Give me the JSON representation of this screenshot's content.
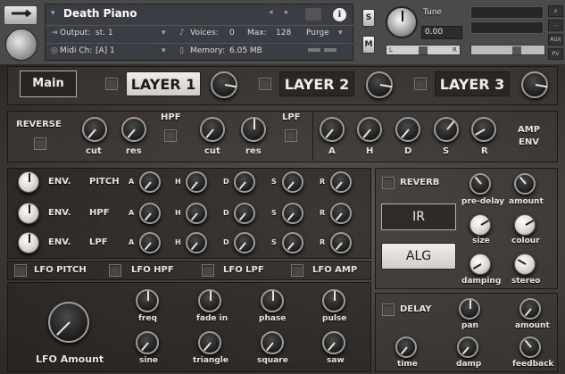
{
  "header": {
    "instrument_name": "Death Piano",
    "output_label": "Output:",
    "output_value": "st. 1",
    "midi_label": "Midi Ch:",
    "midi_value": "[A] 1",
    "voices_label": "Voices:",
    "voices_value": "0",
    "max_label": "Max:",
    "max_value": "128",
    "memory_label": "Memory:",
    "memory_value": "6.05 MB",
    "purge_label": "Purge",
    "solo_label": "S",
    "mute_label": "M",
    "tune_label": "Tune",
    "tune_value": "0.00",
    "pan_left": "L",
    "pan_right": "R",
    "aux_label": "AUX",
    "pv_label": "PV",
    "close_label": "x",
    "minus_label": "-"
  },
  "layers": {
    "main_label": "Main",
    "layer1": "LAYER 1",
    "layer2": "LAYER 2",
    "layer3": "LAYER 3"
  },
  "filters": {
    "reverse": "REVERSE",
    "hpf": "HPF",
    "lpf": "LPF",
    "cut1": "cut",
    "res1": "res",
    "cut2": "cut",
    "res2": "res",
    "a": "A",
    "h": "H",
    "d": "D",
    "s": "S",
    "r": "R",
    "amp_env_1": "AMP",
    "amp_env_2": "ENV"
  },
  "env_rows": [
    {
      "env": "ENV.",
      "target": "PITCH"
    },
    {
      "env": "ENV.",
      "target": "HPF"
    },
    {
      "env": "ENV.",
      "target": "LPF"
    }
  ],
  "env_letters": {
    "a": "A",
    "h": "H",
    "d": "D",
    "s": "S",
    "r": "R"
  },
  "lfo_tabs": {
    "pitch": "LFO PITCH",
    "hpf": "LFO HPF",
    "lpf": "LFO LPF",
    "amp": "LFO AMP"
  },
  "lfo": {
    "amount": "LFO Amount",
    "freq": "freq",
    "fade_in": "fade in",
    "phase": "phase",
    "pulse": "pulse",
    "sine": "sine",
    "triangle": "triangle",
    "square": "square",
    "saw": "saw"
  },
  "reverb": {
    "title": "REVERB",
    "ir": "IR",
    "alg": "ALG",
    "pre_delay": "pre-delay",
    "amount": "amount",
    "size": "size",
    "colour": "colour",
    "damping": "damping",
    "stereo": "stereo"
  },
  "delay": {
    "title": "DELAY",
    "pan": "pan",
    "amount": "amount",
    "time": "time",
    "damp": "damp",
    "feedback": "feedback"
  }
}
